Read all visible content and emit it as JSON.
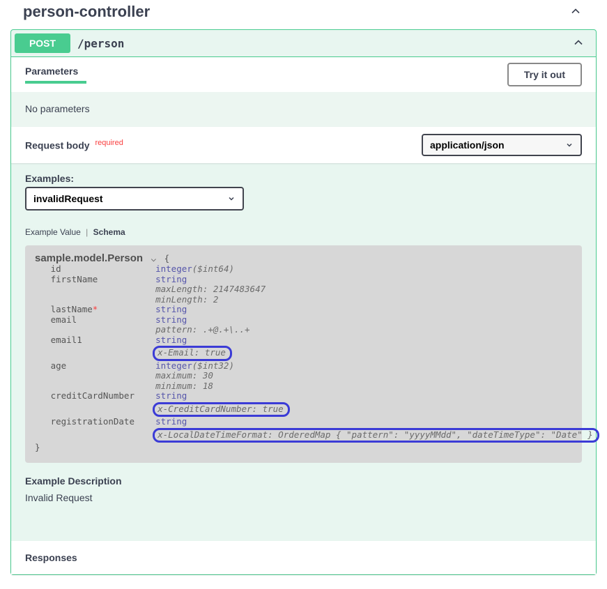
{
  "tag": {
    "name": "person-controller"
  },
  "op": {
    "method": "POST",
    "path": "/person",
    "parameters_title": "Parameters",
    "try_label": "Try it out",
    "no_params": "No parameters",
    "request_body_title": "Request body",
    "required_text": "required",
    "content_type": "application/json",
    "examples_label": "Examples:",
    "selected_example": "invalidRequest",
    "tab_example": "Example Value",
    "tab_schema": "Schema",
    "example_desc_title": "Example Description",
    "example_desc_value": "Invalid Request",
    "responses_title": "Responses"
  },
  "schema": {
    "model_name": "sample.model.Person",
    "open_brace": "{",
    "close_brace": "}",
    "props": {
      "id": {
        "name": "id",
        "type": "integer",
        "format": "($int64)"
      },
      "firstName": {
        "name": "firstName",
        "type": "string",
        "maxLength": "maxLength: 2147483647",
        "minLength": "minLength: 2"
      },
      "lastName": {
        "name": "lastName",
        "type": "string",
        "required_star": "*"
      },
      "email": {
        "name": "email",
        "type": "string",
        "pattern": "pattern: .+@.+\\..+"
      },
      "email1": {
        "name": "email1",
        "type": "string",
        "xEmail": "x-Email: true"
      },
      "age": {
        "name": "age",
        "type": "integer",
        "format": "($int32)",
        "maximum": "maximum: 30",
        "minimum": "minimum: 18"
      },
      "creditCardNumber": {
        "name": "creditCardNumber",
        "type": "string",
        "xCC": "x-CreditCardNumber: true"
      },
      "registrationDate": {
        "name": "registrationDate",
        "type": "string",
        "xLDTF": "x-LocalDateTimeFormat: OrderedMap { \"pattern\": \"yyyyMMdd\", \"dateTimeType\": \"Date\" }"
      }
    }
  }
}
